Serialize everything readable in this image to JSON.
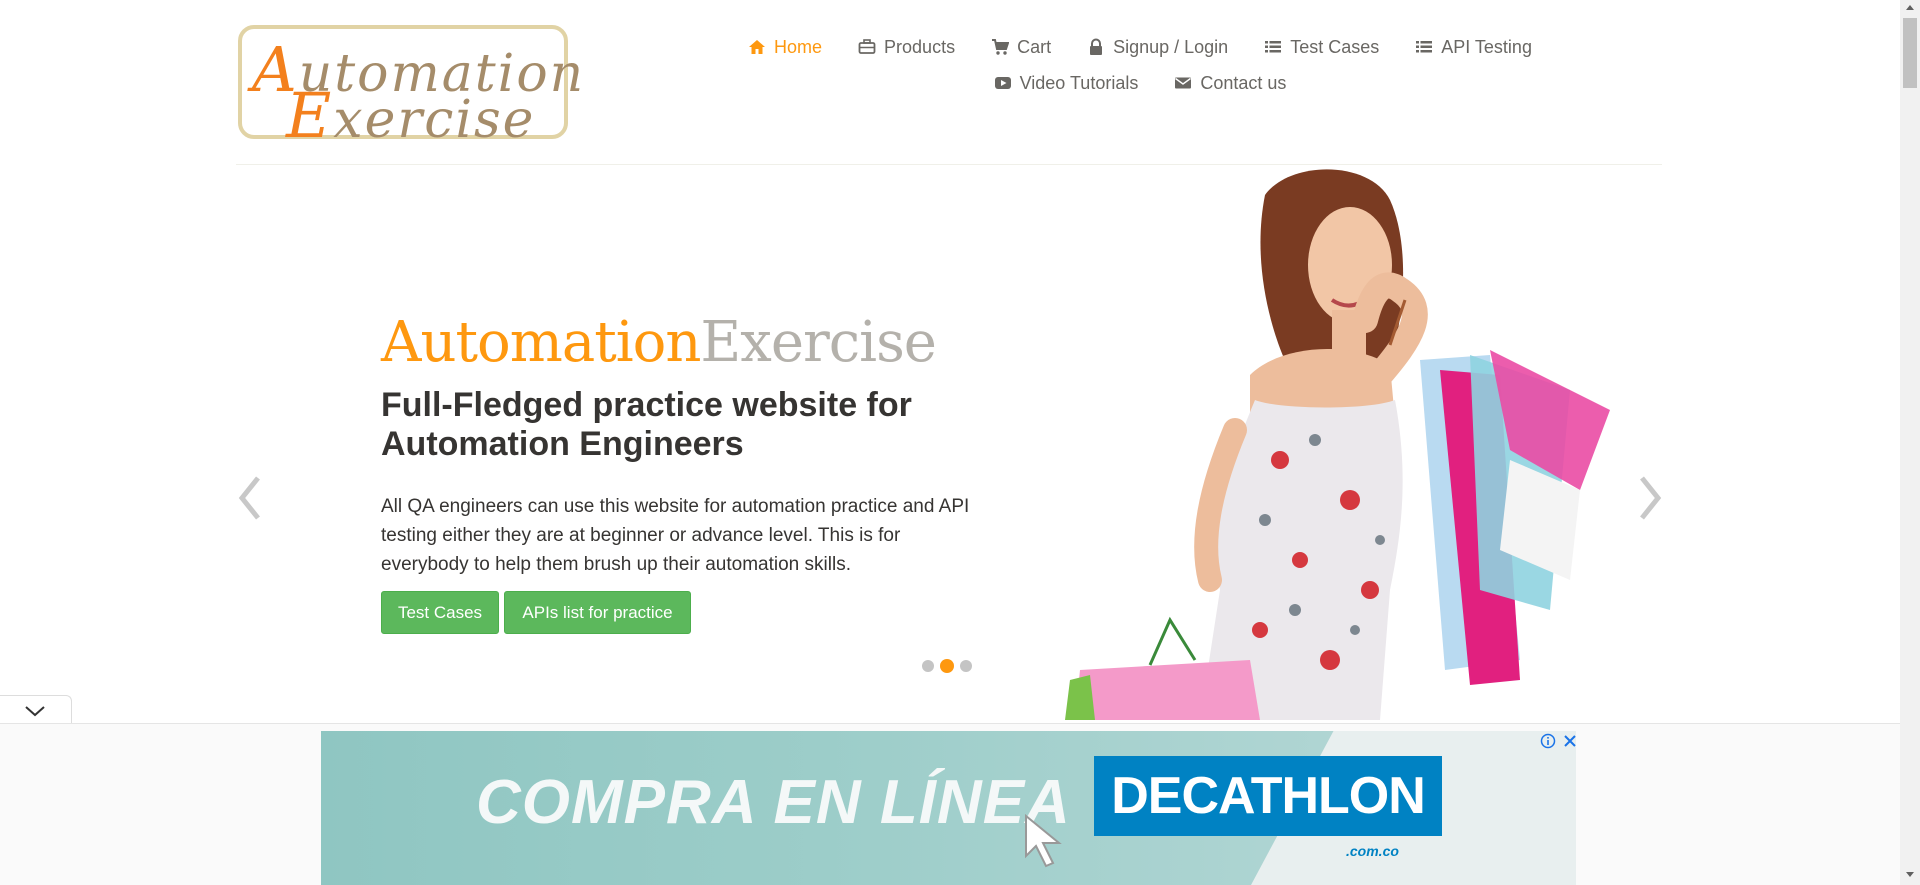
{
  "logo": {
    "line1_cap": "A",
    "line1_rest": "utomation",
    "line2_cap": "E",
    "line2_rest": "xercise"
  },
  "nav": {
    "row1": [
      {
        "label": "Home",
        "icon": "home-icon"
      },
      {
        "label": "Products",
        "icon": "products-icon"
      },
      {
        "label": "Cart",
        "icon": "cart-icon"
      },
      {
        "label": "Signup / Login",
        "icon": "lock-icon"
      },
      {
        "label": "Test Cases",
        "icon": "list-icon"
      },
      {
        "label": "API Testing",
        "icon": "list-icon"
      }
    ],
    "row2": [
      {
        "label": "Video Tutorials",
        "icon": "youtube-icon"
      },
      {
        "label": "Contact us",
        "icon": "envelope-icon"
      }
    ]
  },
  "slider": {
    "brand_a": "Automation",
    "brand_b": "Exercise",
    "headline": "Full-Fledged practice website for Automation Engineers",
    "description": "All QA engineers can use this website for automation practice and API testing either they are at beginner or advance level. This is for everybody to help them brush up their automation skills.",
    "button1": "Test Cases",
    "button2": "APIs list for practice",
    "active_slide": 2,
    "slide_count": 3
  },
  "ad": {
    "text": "COMPRA EN LÍNEA",
    "brand": "DECATHLON",
    "brand_sub": ".com.co"
  },
  "colors": {
    "accent": "#fe980f",
    "button": "#5cb85c",
    "text": "#363432",
    "nav": "#696763"
  }
}
